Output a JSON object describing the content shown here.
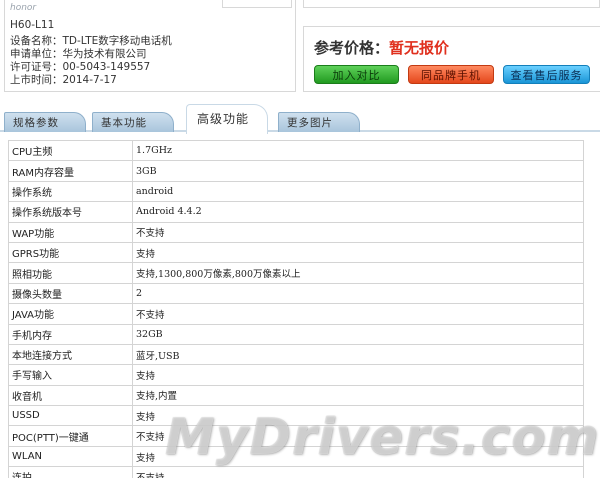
{
  "device": {
    "brand": "honor",
    "model": "H60-L11",
    "lines": [
      {
        "label": "设备名称：",
        "value": "TD-LTE数字移动电话机"
      },
      {
        "label": "申请单位：",
        "value": "华为技术有限公司"
      },
      {
        "label": "许可证号：",
        "value": "00-5043-149557"
      },
      {
        "label": "上市时间：",
        "value": "2014-7-17"
      }
    ]
  },
  "price": {
    "label": "参考价格：",
    "value": "暂无报价"
  },
  "buttons": {
    "compare": "加入对比",
    "same_brand": "同品牌手机",
    "service": "查看售后服务"
  },
  "tabs": {
    "spec": "规格参数",
    "basic": "基本功能",
    "advanced": "高级功能",
    "pics": "更多图片"
  },
  "specs": [
    {
      "key": "CPU主频",
      "value": "1.7GHz"
    },
    {
      "key": "RAM内存容量",
      "value": "3GB"
    },
    {
      "key": "操作系统",
      "value": "android"
    },
    {
      "key": "操作系统版本号",
      "value": "Android 4.4.2"
    },
    {
      "key": "WAP功能",
      "value": "不支持"
    },
    {
      "key": "GPRS功能",
      "value": "支持"
    },
    {
      "key": "照相功能",
      "value": "支持,1300,800万像素,800万像素以上"
    },
    {
      "key": "摄像头数量",
      "value": "2"
    },
    {
      "key": "JAVA功能",
      "value": "不支持"
    },
    {
      "key": "手机内存",
      "value": "32GB"
    },
    {
      "key": "本地连接方式",
      "value": "蓝牙,USB"
    },
    {
      "key": "手写输入",
      "value": "支持"
    },
    {
      "key": "收音机",
      "value": "支持,内置"
    },
    {
      "key": "USSD",
      "value": "支持"
    },
    {
      "key": "POC(PTT)一键通",
      "value": "不支持"
    },
    {
      "key": "WLAN",
      "value": "支持"
    },
    {
      "key": "连拍",
      "value": "不支持"
    }
  ],
  "watermark": "MyDrivers.com"
}
